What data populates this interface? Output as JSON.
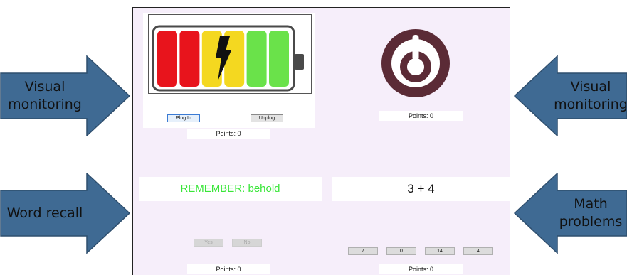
{
  "arrows": [
    {
      "id": "top-left",
      "label": [
        "Visual",
        "monitoring"
      ]
    },
    {
      "id": "bottom-left",
      "label": [
        "Word recall"
      ]
    },
    {
      "id": "top-right",
      "label": [
        "Visual",
        "monitoring"
      ]
    },
    {
      "id": "bottom-right",
      "label": [
        "Math",
        "problems"
      ]
    }
  ],
  "battery_task": {
    "segment_colors": [
      "#e8141c",
      "#e8141c",
      "#f4d820",
      "#f4d820",
      "#6ae24a",
      "#6ae24a"
    ],
    "plug_in_label": "Plug In",
    "unplug_label": "Unplug",
    "points": "Points: 0"
  },
  "dial_task": {
    "points": "Points: 0"
  },
  "word_task": {
    "prompt": "REMEMBER: behold",
    "yes_label": "Yes",
    "no_label": "No",
    "points": "Points: 0"
  },
  "math_task": {
    "problem": "3 + 4",
    "choices": [
      "7",
      "0",
      "14",
      "4"
    ],
    "points": "Points: 0"
  },
  "colors": {
    "arrow_fill": "#3f6a93",
    "panel_bg": "#f6eefa",
    "dial_color": "#5b2b36",
    "word_text": "#39e639"
  }
}
